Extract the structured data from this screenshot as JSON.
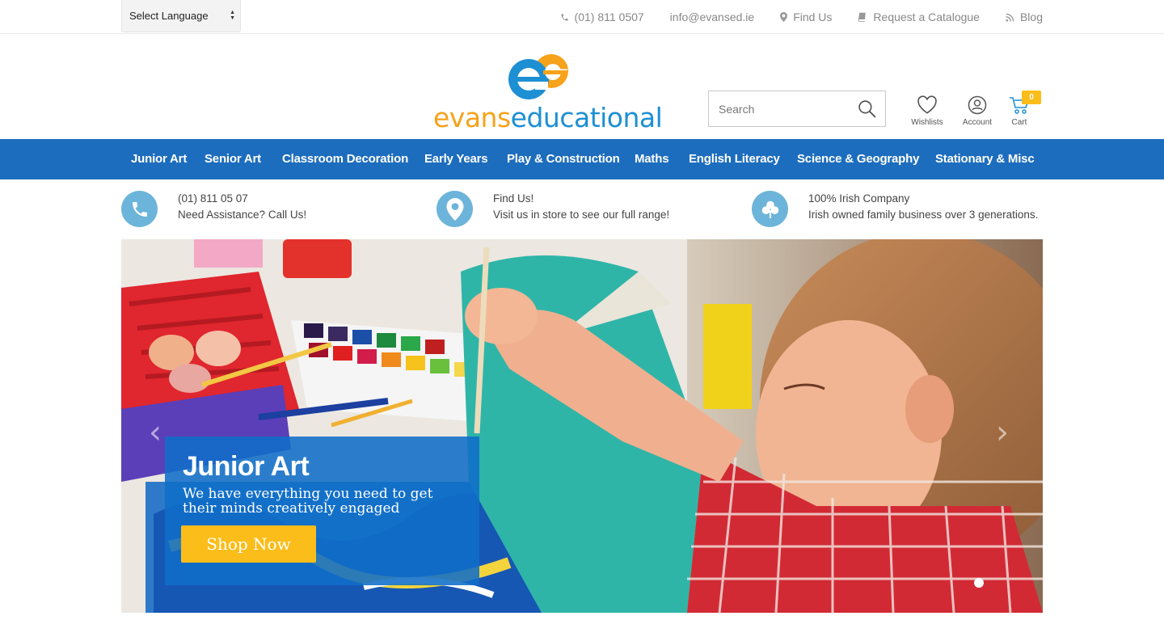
{
  "topbar": {
    "language_select": "Select Language",
    "phone": "(01) 811 0507",
    "email": "info@evansed.ie",
    "find_us": "Find Us",
    "catalogue": "Request a Catalogue",
    "blog": "Blog"
  },
  "logo": {
    "part1": "evans",
    "part2": "educational"
  },
  "search": {
    "placeholder": "Search"
  },
  "header_icons": {
    "wishlists": "Wishlists",
    "account": "Account",
    "cart": "Cart",
    "cart_count": "0"
  },
  "nav": {
    "items": [
      "Junior Art",
      "Senior Art",
      "Classroom Decoration",
      "Early Years",
      "Play & Construction",
      "Maths",
      "English Literacy",
      "Science & Geography",
      "Stationary & Misc"
    ]
  },
  "info": [
    {
      "line1": "(01) 811 05 07",
      "line2": "Need Assistance? Call Us!",
      "icon": "phone-icon"
    },
    {
      "line1": "Find Us!",
      "line2": "Visit us in store to see our full range!",
      "icon": "map-pin-icon"
    },
    {
      "line1": "100% Irish Company",
      "line2": "Irish owned family business over 3 generations.",
      "icon": "shamrock-icon"
    }
  ],
  "hero": {
    "title": "Junior Art",
    "subtitle": "We have everything you need to get their minds creatively engaged",
    "button": "Shop Now",
    "prev": "‹",
    "next": "›"
  },
  "colors": {
    "nav_blue": "#1d6dbe",
    "accent_yellow": "#fbbd1a",
    "logo_orange": "#f7a21b",
    "logo_blue": "#1d8fd3",
    "info_icon_bg": "#6cb4da"
  }
}
